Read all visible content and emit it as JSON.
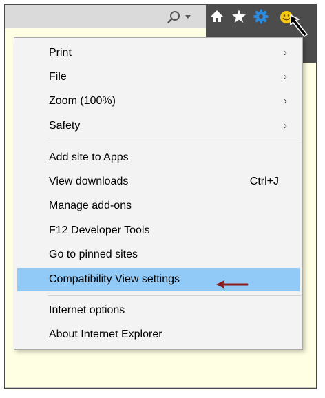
{
  "toolbar": {
    "icons": [
      "search-icon",
      "home-icon",
      "star-icon",
      "gear-icon",
      "smiley-icon"
    ],
    "gear_color": "#2b8be0",
    "smiley_color": "#f6c915"
  },
  "menu": {
    "groups": [
      {
        "items": [
          {
            "label": "Print",
            "has_submenu": true
          },
          {
            "label": "File",
            "has_submenu": true
          },
          {
            "label": "Zoom (100%)",
            "has_submenu": true
          },
          {
            "label": "Safety",
            "has_submenu": true
          }
        ]
      },
      {
        "items": [
          {
            "label": "Add site to Apps"
          },
          {
            "label": "View downloads",
            "shortcut": "Ctrl+J"
          },
          {
            "label": "Manage add-ons"
          },
          {
            "label": "F12 Developer Tools"
          },
          {
            "label": "Go to pinned sites"
          },
          {
            "label": "Compatibility View settings",
            "highlighted": true
          }
        ]
      },
      {
        "items": [
          {
            "label": "Internet options"
          },
          {
            "label": "About Internet Explorer"
          }
        ]
      }
    ],
    "submenu_glyph": "›",
    "highlight_color": "#91c9f7",
    "annotation_arrow_color": "#8b1a1a"
  }
}
